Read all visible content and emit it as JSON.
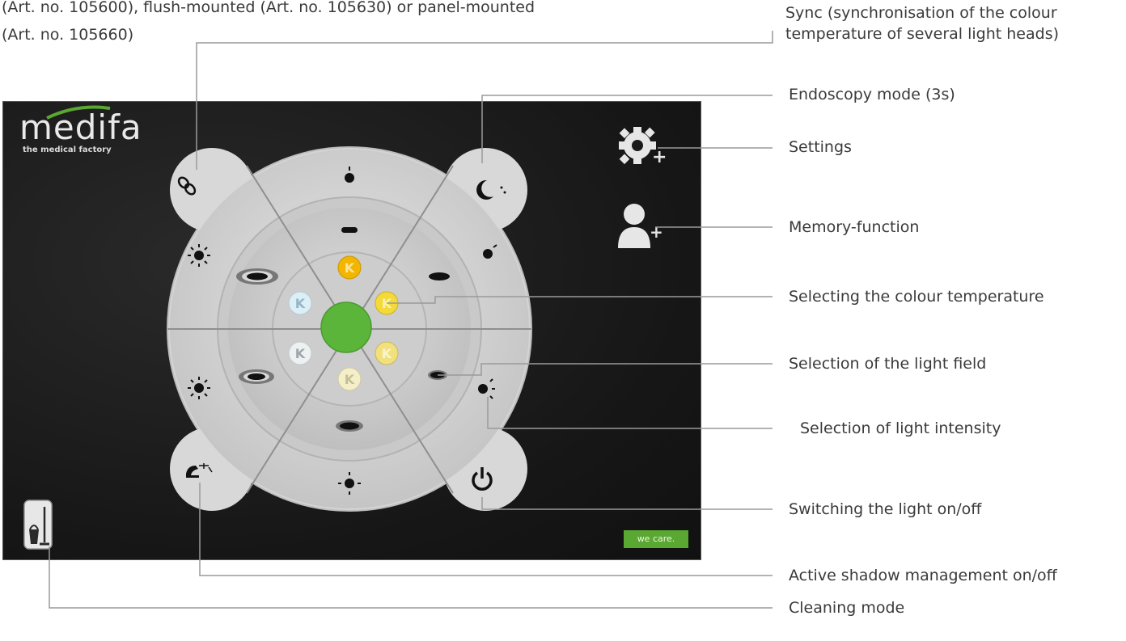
{
  "top_text": {
    "line1": "(Art. no. 105600), flush-mounted (Art. no. 105630) or panel-mounted",
    "line2": "(Art. no. 105660)"
  },
  "screen": {
    "logo_word": "medifa",
    "logo_sub": "the medical factory",
    "badge": "we care.",
    "color_temp_letter": "K"
  },
  "callouts": {
    "sync_l1": "Sync (synchronisation of the colour",
    "sync_l2": "temperature of several light heads)",
    "endoscopy": "Endoscopy mode (3s)",
    "settings": "Settings",
    "memory": "Memory-function",
    "colour_temp": "Selecting the colour temperature",
    "light_field": "Selection of the light field",
    "light_intensity": "Selection of light intensity",
    "on_off": "Switching the light on/off",
    "shadow": "Active shadow management on/off",
    "cleaning": "Cleaning mode"
  },
  "colors": {
    "active_button": "#5bb53a",
    "brand_green": "#5aa832",
    "panel_background": "#161616",
    "control_grey": "#d7d7d7",
    "leader_line": "#9a9a9a"
  }
}
